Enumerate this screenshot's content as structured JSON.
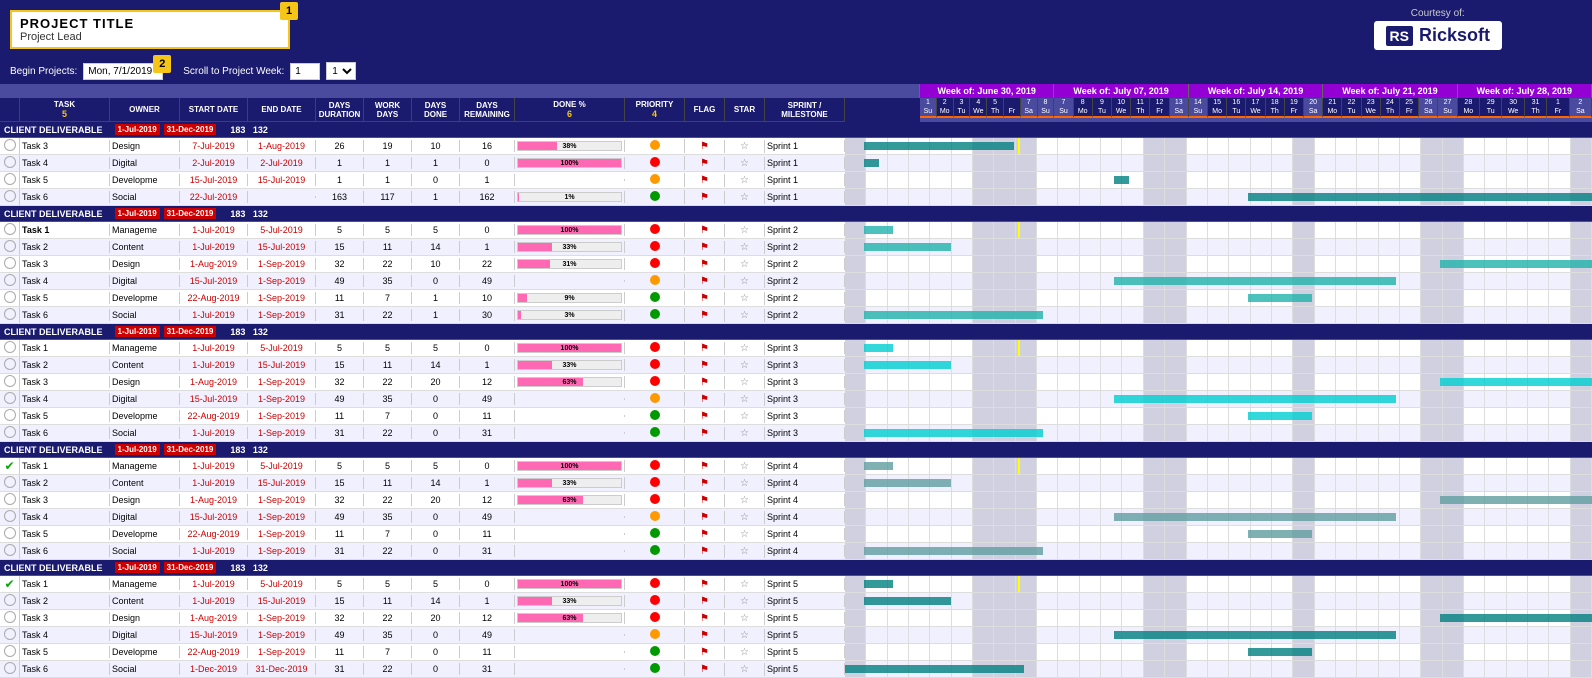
{
  "header": {
    "project_title": "PROJECT TITLE",
    "project_lead": "Project Lead",
    "badge1": "1",
    "courtesy": "Courtesy of:",
    "logo_rs": "RS",
    "logo_name": "Ricksoft"
  },
  "controls": {
    "begin_label": "Begin Projects:",
    "begin_value": "Mon, 7/1/2019",
    "begin_badge": "2",
    "scroll_label": "Scroll to Project Week:",
    "scroll_value": "1"
  },
  "columns": {
    "task": "TASK",
    "owner": "OWNER",
    "start": "START DATE",
    "end": "END DATE",
    "days_dur": "DAYS DURATION",
    "work_days": "WORK DAYS",
    "days_done": "DAYS DONE",
    "days_rem": "DAYS REMAINING",
    "done_pct": "DONE %",
    "priority": "PRIORITY",
    "flag": "FLAG",
    "star": "STAR",
    "sprint": "SPRINT / MILESTONE",
    "badge5": "5",
    "badge6": "6",
    "badge4": "4"
  },
  "weeks": [
    {
      "label": "Week of: June 30, 2019",
      "days": [
        "1",
        "2",
        "3",
        "4",
        "5",
        "",
        "7",
        "8"
      ],
      "daynames": [
        "Su",
        "Mo",
        "Tu",
        "We",
        "Th",
        "Fr",
        "Sa",
        "Su"
      ]
    },
    {
      "label": "Week of: July 07, 2019",
      "days": [
        "7",
        "8",
        "9",
        "10",
        "11",
        "12",
        "13"
      ],
      "daynames": [
        "Su",
        "Mo",
        "Tu",
        "We",
        "Th",
        "Fr",
        "Sa"
      ]
    },
    {
      "label": "Week of: July 14, 2019",
      "days": [
        "14",
        "15",
        "16",
        "17",
        "18",
        "19",
        "20"
      ],
      "daynames": [
        "Su",
        "Mo",
        "Tu",
        "We",
        "Th",
        "Fr",
        "Sa"
      ]
    },
    {
      "label": "Week of: July 21, 2019",
      "days": [
        "21",
        "22",
        "23",
        "24",
        "25",
        "26",
        "27"
      ],
      "daynames": [
        "Mo",
        "Tu",
        "We",
        "Th",
        "Fr",
        "Sa",
        "Su"
      ]
    },
    {
      "label": "Week of: July 28, 2019",
      "days": [
        "28",
        "29",
        "30",
        "31",
        "1",
        "2"
      ],
      "daynames": [
        "Mo",
        "Tu",
        "We",
        "Th",
        "Fr",
        "Sa"
      ]
    }
  ],
  "sprints": [
    {
      "label": "CLIENT DELIVERABLE",
      "start": "1-Jul-2019",
      "end": "31-Dec-2019",
      "days": "183",
      "work": "132",
      "sprint_label": "",
      "tasks": [
        {
          "check": "empty",
          "name": "Task 3",
          "owner": "Design",
          "start": "7-Jul-2019",
          "end": "1-Aug-2019",
          "days": 26,
          "work": 19,
          "done": 10,
          "remain": 16,
          "pct": 38,
          "priority": "medium",
          "priority_color": "#ff9900",
          "flag": true,
          "star": false,
          "sprint": "Sprint 1"
        },
        {
          "check": "empty",
          "name": "Task 4",
          "owner": "Digital",
          "start": "2-Jul-2019",
          "end": "2-Jul-2019",
          "days": 1,
          "work": 1,
          "done": 1,
          "remain": 0,
          "pct": 100,
          "priority": "high",
          "priority_color": "#ff0000",
          "flag": true,
          "star": false,
          "sprint": "Sprint 1"
        },
        {
          "check": "empty",
          "name": "Task 5",
          "owner": "Developme",
          "start": "15-Jul-2019",
          "end": "15-Jul-2019",
          "days": 1,
          "work": 1,
          "done": 0,
          "remain": 1,
          "pct": 0,
          "priority": "medium",
          "priority_color": "#ff9900",
          "flag": true,
          "star": false,
          "sprint": "Sprint 1"
        },
        {
          "check": "empty",
          "name": "Task 6",
          "owner": "Social",
          "start": "22-Jul-2019",
          "end": "",
          "days": 163,
          "work": 117,
          "done": 1,
          "remain": 162,
          "pct": 1,
          "priority": "low",
          "priority_color": "#009900",
          "flag": true,
          "star": false,
          "sprint": "Sprint 1"
        }
      ]
    },
    {
      "label": "CLIENT DELIVERABLE",
      "start": "1-Jul-2019",
      "end": "31-Dec-2019",
      "days": "183",
      "work": "132",
      "tasks": [
        {
          "check": "empty",
          "name": "Task 1",
          "owner": "Manageme",
          "start": "1-Jul-2019",
          "end": "5-Jul-2019",
          "days": 5,
          "work": 5,
          "done": 5,
          "remain": 0,
          "pct": 100,
          "priority": "high",
          "priority_color": "#ff0000",
          "flag": true,
          "star": false,
          "sprint": "Sprint 2",
          "badge3": true
        },
        {
          "check": "empty",
          "name": "Task 2",
          "owner": "Content",
          "start": "1-Jul-2019",
          "end": "15-Jul-2019",
          "days": 15,
          "work": 11,
          "done": 14,
          "remain": 1,
          "pct": 33,
          "priority": "high",
          "priority_color": "#ff0000",
          "flag": true,
          "star": false,
          "sprint": "Sprint 2"
        },
        {
          "check": "empty",
          "name": "Task 3",
          "owner": "Design",
          "start": "1-Aug-2019",
          "end": "1-Sep-2019",
          "days": 32,
          "work": 22,
          "done": 10,
          "remain": 22,
          "pct": 31,
          "priority": "high",
          "priority_color": "#ff0000",
          "flag": true,
          "star": false,
          "sprint": "Sprint 2"
        },
        {
          "check": "empty",
          "name": "Task 4",
          "owner": "Digital",
          "start": "15-Jul-2019",
          "end": "1-Sep-2019",
          "days": 49,
          "work": 35,
          "done": 0,
          "remain": 49,
          "pct": 0,
          "priority": "medium",
          "priority_color": "#ff9900",
          "flag": true,
          "star": false,
          "sprint": "Sprint 2"
        },
        {
          "check": "empty",
          "name": "Task 5",
          "owner": "Developme",
          "start": "22-Aug-2019",
          "end": "1-Sep-2019",
          "days": 11,
          "work": 7,
          "done": 1,
          "remain": 10,
          "pct": 9,
          "priority": "medium",
          "priority_color": "#009900",
          "flag": true,
          "star": false,
          "sprint": "Sprint 2"
        },
        {
          "check": "empty",
          "name": "Task 6",
          "owner": "Social",
          "start": "1-Jul-2019",
          "end": "1-Sep-2019",
          "days": 31,
          "work": 22,
          "done": 1,
          "remain": 30,
          "pct": 3,
          "priority": "low",
          "priority_color": "#009900",
          "flag": true,
          "star": false,
          "sprint": "Sprint 2"
        }
      ]
    },
    {
      "label": "CLIENT DELIVERABLE",
      "start": "1-Jul-2019",
      "end": "31-Dec-2019",
      "days": "183",
      "work": "132",
      "tasks": [
        {
          "check": "empty",
          "name": "Task 1",
          "owner": "Manageme",
          "start": "1-Jul-2019",
          "end": "5-Jul-2019",
          "days": 5,
          "work": 5,
          "done": 5,
          "remain": 0,
          "pct": 100,
          "priority": "high",
          "priority_color": "#ff0000",
          "flag": true,
          "star": false,
          "sprint": "Sprint 3"
        },
        {
          "check": "empty",
          "name": "Task 2",
          "owner": "Content",
          "start": "1-Jul-2019",
          "end": "15-Jul-2019",
          "days": 15,
          "work": 11,
          "done": 14,
          "remain": 1,
          "pct": 33,
          "priority": "high",
          "priority_color": "#ff0000",
          "flag": true,
          "star": false,
          "sprint": "Sprint 3"
        },
        {
          "check": "empty",
          "name": "Task 3",
          "owner": "Design",
          "start": "1-Aug-2019",
          "end": "1-Sep-2019",
          "days": 32,
          "work": 22,
          "done": 20,
          "remain": 12,
          "pct": 63,
          "priority": "high",
          "priority_color": "#ff0000",
          "flag": true,
          "star": false,
          "sprint": "Sprint 3"
        },
        {
          "check": "empty",
          "name": "Task 4",
          "owner": "Digital",
          "start": "15-Jul-2019",
          "end": "1-Sep-2019",
          "days": 49,
          "work": 35,
          "done": 0,
          "remain": 49,
          "pct": 0,
          "priority": "medium",
          "priority_color": "#ff9900",
          "flag": true,
          "star": false,
          "sprint": "Sprint 3"
        },
        {
          "check": "empty",
          "name": "Task 5",
          "owner": "Developme",
          "start": "22-Aug-2019",
          "end": "1-Sep-2019",
          "days": 11,
          "work": 7,
          "done": 0,
          "remain": 11,
          "pct": 0,
          "priority": "medium",
          "priority_color": "#009900",
          "flag": true,
          "star": false,
          "sprint": "Sprint 3"
        },
        {
          "check": "empty",
          "name": "Task 6",
          "owner": "Social",
          "start": "1-Jul-2019",
          "end": "1-Sep-2019",
          "days": 31,
          "work": 22,
          "done": 0,
          "remain": 31,
          "pct": 0,
          "priority": "low",
          "priority_color": "#009900",
          "flag": true,
          "star": false,
          "sprint": "Sprint 3"
        }
      ]
    },
    {
      "label": "CLIENT DELIVERABLE",
      "start": "1-Jul-2019",
      "end": "31-Dec-2019",
      "days": "183",
      "work": "132",
      "tasks": [
        {
          "check": "done",
          "name": "Task 1",
          "owner": "Manageme",
          "start": "1-Jul-2019",
          "end": "5-Jul-2019",
          "days": 5,
          "work": 5,
          "done": 5,
          "remain": 0,
          "pct": 100,
          "priority": "high",
          "priority_color": "#ff0000",
          "flag": true,
          "star": false,
          "sprint": "Sprint 4"
        },
        {
          "check": "empty",
          "name": "Task 2",
          "owner": "Content",
          "start": "1-Jul-2019",
          "end": "15-Jul-2019",
          "days": 15,
          "work": 11,
          "done": 14,
          "remain": 1,
          "pct": 33,
          "priority": "high",
          "priority_color": "#ff0000",
          "flag": true,
          "star": false,
          "sprint": "Sprint 4"
        },
        {
          "check": "empty",
          "name": "Task 3",
          "owner": "Design",
          "start": "1-Aug-2019",
          "end": "1-Sep-2019",
          "days": 32,
          "work": 22,
          "done": 20,
          "remain": 12,
          "pct": 63,
          "priority": "high",
          "priority_color": "#ff0000",
          "flag": true,
          "star": false,
          "sprint": "Sprint 4"
        },
        {
          "check": "empty",
          "name": "Task 4",
          "owner": "Digital",
          "start": "15-Jul-2019",
          "end": "1-Sep-2019",
          "days": 49,
          "work": 35,
          "done": 0,
          "remain": 49,
          "pct": 0,
          "priority": "medium",
          "priority_color": "#ff9900",
          "flag": true,
          "star": false,
          "sprint": "Sprint 4"
        },
        {
          "check": "empty",
          "name": "Task 5",
          "owner": "Developme",
          "start": "22-Aug-2019",
          "end": "1-Sep-2019",
          "days": 11,
          "work": 7,
          "done": 0,
          "remain": 11,
          "pct": 0,
          "priority": "medium",
          "priority_color": "#009900",
          "flag": true,
          "star": false,
          "sprint": "Sprint 4"
        },
        {
          "check": "empty",
          "name": "Task 6",
          "owner": "Social",
          "start": "1-Jul-2019",
          "end": "1-Sep-2019",
          "days": 31,
          "work": 22,
          "done": 0,
          "remain": 31,
          "pct": 0,
          "priority": "low",
          "priority_color": "#009900",
          "flag": true,
          "star": false,
          "sprint": "Sprint 4"
        }
      ]
    },
    {
      "label": "CLIENT DELIVERABLE",
      "start": "1-Jul-2019",
      "end": "31-Dec-2019",
      "days": "183",
      "work": "132",
      "tasks": [
        {
          "check": "done",
          "name": "Task 1",
          "owner": "Manageme",
          "start": "1-Jul-2019",
          "end": "5-Jul-2019",
          "days": 5,
          "work": 5,
          "done": 5,
          "remain": 0,
          "pct": 100,
          "priority": "high",
          "priority_color": "#ff0000",
          "flag": true,
          "star": false,
          "sprint": "Sprint 5"
        },
        {
          "check": "empty",
          "name": "Task 2",
          "owner": "Content",
          "start": "1-Jul-2019",
          "end": "15-Jul-2019",
          "days": 15,
          "work": 11,
          "done": 14,
          "remain": 1,
          "pct": 33,
          "priority": "high",
          "priority_color": "#ff0000",
          "flag": true,
          "star": false,
          "sprint": "Sprint 5"
        },
        {
          "check": "empty",
          "name": "Task 3",
          "owner": "Design",
          "start": "1-Aug-2019",
          "end": "1-Sep-2019",
          "days": 32,
          "work": 22,
          "done": 20,
          "remain": 12,
          "pct": 63,
          "priority": "high",
          "priority_color": "#ff0000",
          "flag": true,
          "star": false,
          "sprint": "Sprint 5"
        },
        {
          "check": "empty",
          "name": "Task 4",
          "owner": "Digital",
          "start": "15-Jul-2019",
          "end": "1-Sep-2019",
          "days": 49,
          "work": 35,
          "done": 0,
          "remain": 49,
          "pct": 0,
          "priority": "medium",
          "priority_color": "#ff9900",
          "flag": true,
          "star": false,
          "sprint": "Sprint 5"
        },
        {
          "check": "empty",
          "name": "Task 5",
          "owner": "Developme",
          "start": "22-Aug-2019",
          "end": "1-Sep-2019",
          "days": 11,
          "work": 7,
          "done": 0,
          "remain": 11,
          "pct": 0,
          "priority": "medium",
          "priority_color": "#009900",
          "flag": true,
          "star": false,
          "sprint": "Sprint 5"
        },
        {
          "check": "empty",
          "name": "Task 6",
          "owner": "Social",
          "start": "1-Dec-2019",
          "end": "31-Dec-2019",
          "days": 31,
          "work": 22,
          "done": 0,
          "remain": 31,
          "pct": 0,
          "priority": "low",
          "priority_color": "#009900",
          "flag": true,
          "star": false,
          "sprint": "Sprint 5"
        }
      ]
    }
  ],
  "colors": {
    "header_bg": "#1a1a6e",
    "week_bg": "#9400d3",
    "today_line": "#ffff00",
    "gantt_bar": "#008080",
    "gantt_bar_light": "#00aaaa",
    "deliverable_bg": "#1a1a6e",
    "accent": "#ff6600"
  }
}
